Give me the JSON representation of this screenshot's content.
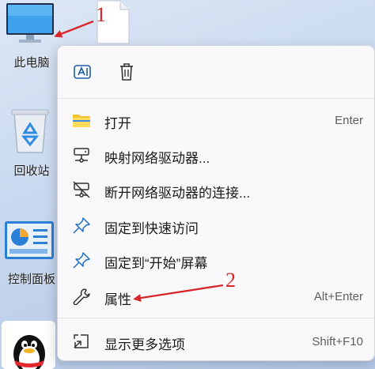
{
  "desktop": {
    "icons": [
      {
        "label": "此电脑",
        "icon": "computer-icon"
      },
      {
        "label": "回收站",
        "icon": "recycle-bin-icon"
      },
      {
        "label": "控制面板",
        "icon": "control-panel-icon"
      },
      {
        "label": "",
        "icon": "qq-penguin-icon"
      }
    ]
  },
  "annotations": {
    "step1": "1",
    "step2": "2",
    "arrow_color": "#d9262b"
  },
  "context_menu": {
    "toolbar": [
      {
        "icon": "rename-icon"
      },
      {
        "icon": "delete-icon"
      }
    ],
    "items": [
      {
        "label": "打开",
        "shortcut": "Enter",
        "icon": "folder-icon"
      },
      {
        "label": "映射网络驱动器...",
        "shortcut": "",
        "icon": "map-network-drive-icon"
      },
      {
        "label": "断开网络驱动器的连接...",
        "shortcut": "",
        "icon": "disconnect-network-drive-icon"
      },
      {
        "label": "固定到快速访问",
        "shortcut": "",
        "icon": "pin-icon"
      },
      {
        "label": "固定到“开始”屏幕",
        "shortcut": "",
        "icon": "pin-icon"
      },
      {
        "label": "属性",
        "shortcut": "Alt+Enter",
        "icon": "wrench-icon"
      },
      {
        "label": "显示更多选项",
        "shortcut": "Shift+F10",
        "icon": "show-more-icon"
      }
    ]
  },
  "colors": {
    "folder": "#f4c430",
    "accent": "#0067c0",
    "annotation": "#d9262b"
  }
}
